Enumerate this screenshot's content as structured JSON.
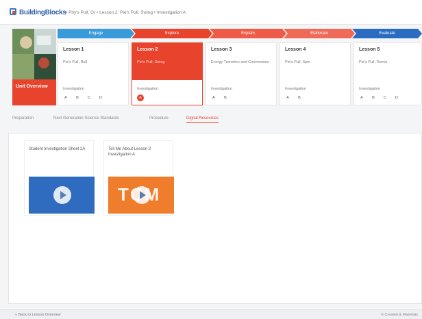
{
  "app": {
    "brand": "BuildingBlocks",
    "breadcrumb": "• Phy's Pull, Gr • Lesson 2: Pie's Pull, Swing • Investigation A"
  },
  "overview": {
    "label": "Unit Overview"
  },
  "phases": [
    "Engage",
    "Explore",
    "Explain",
    "Elaborate",
    "Evaluate"
  ],
  "lessons": [
    {
      "title": "Lesson 1",
      "subtitle": "Pie's Pull, Roll",
      "investigation": "Investigation",
      "steps": [
        "A",
        "B",
        "C",
        "D"
      ]
    },
    {
      "title": "Lesson 2",
      "subtitle": "Pie's Pull, Swing",
      "investigation": "Investigation",
      "steps": [
        "A"
      ]
    },
    {
      "title": "Lesson 3",
      "subtitle": "Energy Transfers and Conversions",
      "investigation": "Investigation",
      "steps": [
        "A",
        "B"
      ]
    },
    {
      "title": "Lesson 4",
      "subtitle": "Pie's Pull, Spin",
      "investigation": "Investigation",
      "steps": [
        "A",
        "B"
      ]
    },
    {
      "title": "Lesson 5",
      "subtitle": "Pie's Pull, Tennis",
      "investigation": "Investigation",
      "steps": [
        "A",
        "B",
        "C",
        "D"
      ]
    }
  ],
  "tabs": [
    "Preparation",
    "Next Generation Science Standards",
    "Procedure",
    "Digital Resources"
  ],
  "active_tab": "Digital Resources",
  "resources": [
    {
      "title": "Student Investigation Sheet 2A",
      "thumb": "video-thumbnail-blue"
    },
    {
      "title": "Tell Me About Lesson 2 Investigation A",
      "thumb": "video-thumbnail-tcm",
      "thumb_text": "TCM"
    }
  ],
  "footer": {
    "left": "« Back to Lesson Overview",
    "right": "© Created & Materials"
  },
  "colors": {
    "accent": "#e8432d",
    "blue": "#3b9ad9",
    "dark_blue": "#2a6cbf",
    "orange": "#f07d2c"
  }
}
